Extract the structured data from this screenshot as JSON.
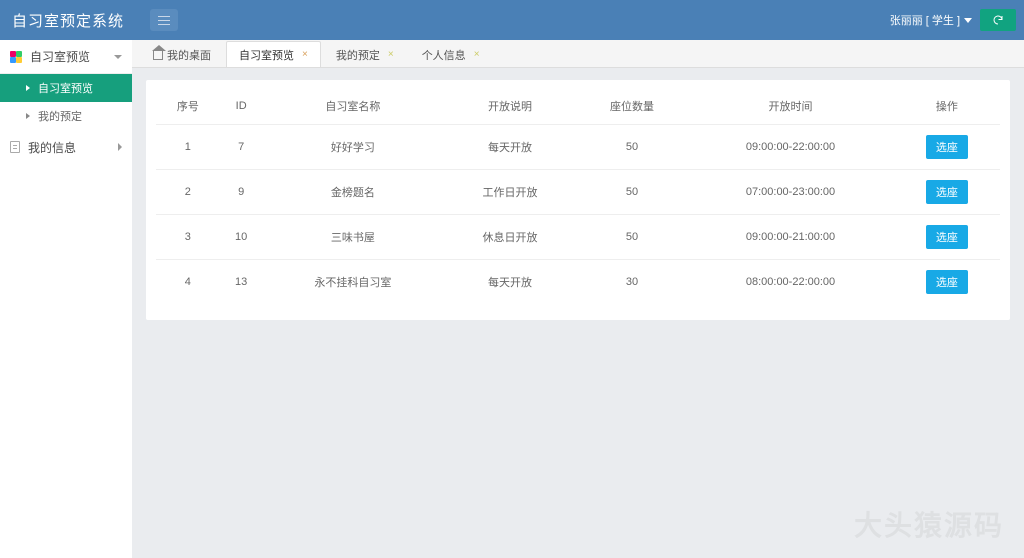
{
  "header": {
    "title": "自习室预定系统",
    "user_text": "张丽丽 [ 学生 ]"
  },
  "sidebar": {
    "cat_preview": "自习室预览",
    "sub_preview": "自习室预览",
    "sub_myreserve": "我的预定",
    "my_info": "我的信息"
  },
  "tabs": {
    "home": "我的桌面",
    "preview": "自习室预览",
    "myreserve": "我的预定",
    "personal": "个人信息"
  },
  "table": {
    "headers": {
      "seq": "序号",
      "id": "ID",
      "name": "自习室名称",
      "open_desc": "开放说明",
      "seats": "座位数量",
      "open_time": "开放时间",
      "ops": "操作"
    },
    "rows": [
      {
        "seq": "1",
        "id": "7",
        "name": "好好学习",
        "open_desc": "每天开放",
        "seats": "50",
        "open_time": "09:00:00-22:00:00",
        "op": "选座"
      },
      {
        "seq": "2",
        "id": "9",
        "name": "金榜题名",
        "open_desc": "工作日开放",
        "seats": "50",
        "open_time": "07:00:00-23:00:00",
        "op": "选座"
      },
      {
        "seq": "3",
        "id": "10",
        "name": "三味书屋",
        "open_desc": "休息日开放",
        "seats": "50",
        "open_time": "09:00:00-21:00:00",
        "op": "选座"
      },
      {
        "seq": "4",
        "id": "13",
        "name": "永不挂科自习室",
        "open_desc": "每天开放",
        "seats": "30",
        "open_time": "08:00:00-22:00:00",
        "op": "选座"
      }
    ]
  },
  "watermark": "大头猿源码"
}
